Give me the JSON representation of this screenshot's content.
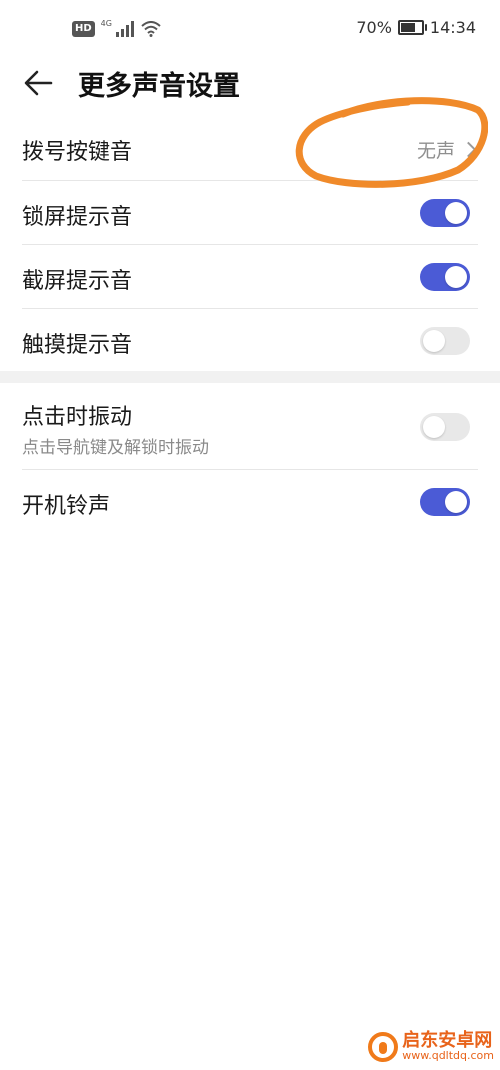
{
  "status_bar": {
    "hd": "HD",
    "network": "4G",
    "battery_percent": "70%",
    "battery_level": 0.7,
    "time": "14:34"
  },
  "header": {
    "back_icon": "arrow-left-icon",
    "title": "更多声音设置"
  },
  "settings": {
    "dial_tone": {
      "label": "拨号按键音",
      "value": "无声"
    },
    "lock_screen": {
      "label": "锁屏提示音",
      "enabled": true
    },
    "screenshot": {
      "label": "截屏提示音",
      "enabled": true
    },
    "touch": {
      "label": "触摸提示音",
      "enabled": false
    },
    "vibrate_on_tap": {
      "label": "点击时振动",
      "sublabel": "点击导航键及解锁时振动",
      "enabled": false
    },
    "boot_ringtone": {
      "label": "开机铃声",
      "enabled": true
    }
  },
  "colors": {
    "toggle_on": "#4b5bd6",
    "toggle_off": "#e8e8e8",
    "annotation": "#f08a2a"
  },
  "watermark": {
    "name": "启东安卓网",
    "url": "www.qdltdq.com"
  }
}
